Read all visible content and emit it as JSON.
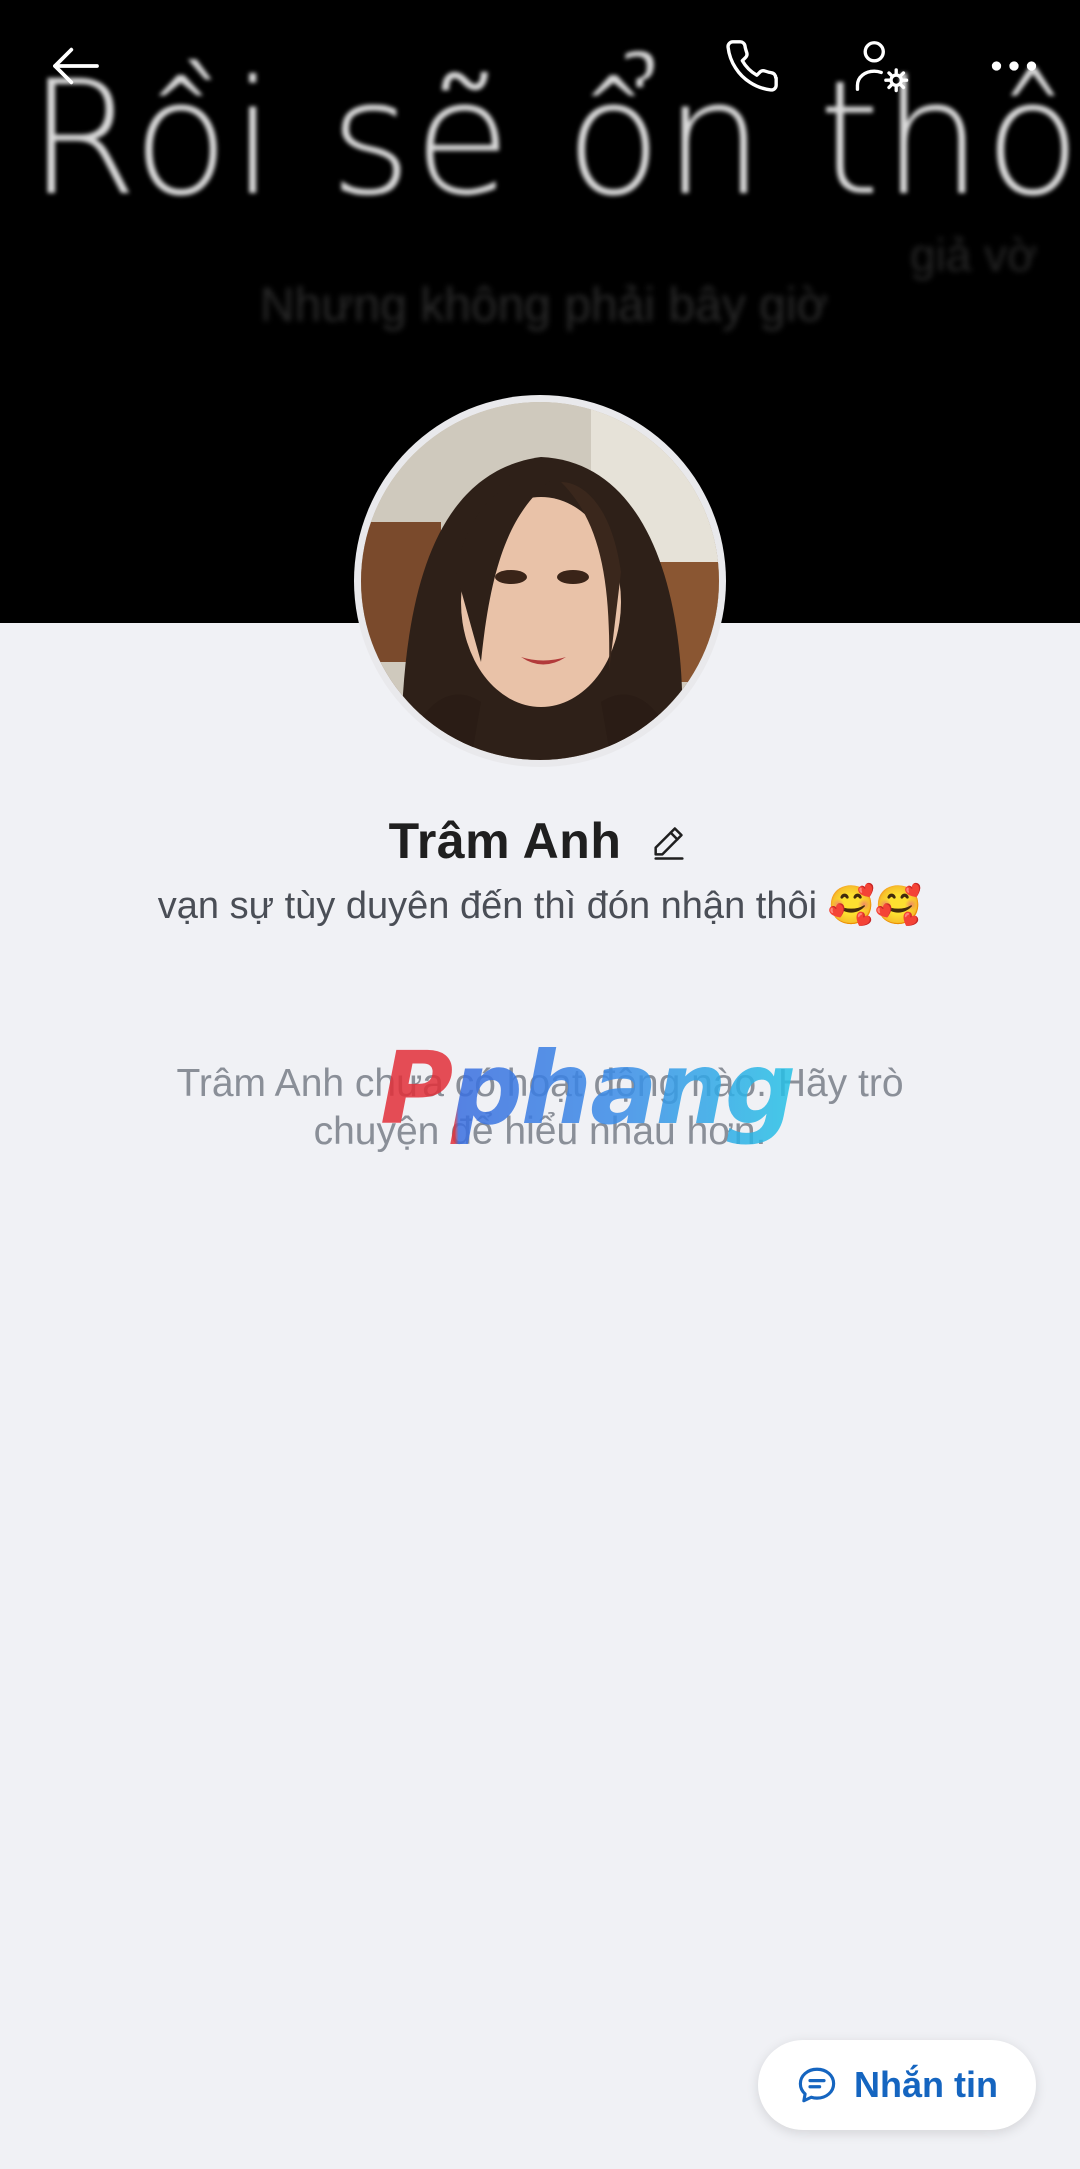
{
  "cover": {
    "title": "Rồi sẽ ổn thôi =",
    "faint_line": "Nhưng không phải bây giờ",
    "faint_line_2": "giả vờ"
  },
  "topbar": {
    "back_icon": "arrow-left-icon",
    "call_icon": "phone-icon",
    "settings_icon": "user-settings-icon",
    "more_icon": "more-horizontal-icon"
  },
  "profile": {
    "name": "Trâm Anh",
    "status": "vạn sự tùy duyên đến thì đón nhận thôi 🥰🥰"
  },
  "empty_state": {
    "message": "Trâm Anh chưa có hoạt động nào. Hãy trò chuyện để hiểu nhau hơn."
  },
  "watermark": "Pphang",
  "message_button": {
    "label": "Nhắn tin",
    "icon": "chat-bubble-icon",
    "color": "#1565c0"
  }
}
